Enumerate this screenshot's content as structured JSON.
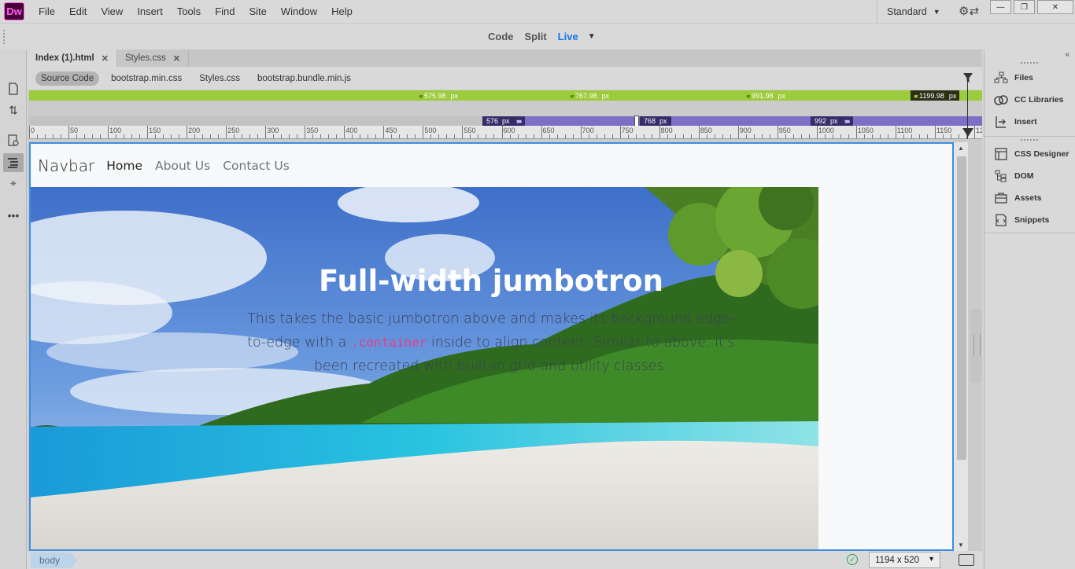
{
  "app": {
    "logo": "Dw"
  },
  "menu": [
    "File",
    "Edit",
    "View",
    "Insert",
    "Tools",
    "Find",
    "Site",
    "Window",
    "Help"
  ],
  "workspace": {
    "label": "Standard"
  },
  "view_modes": {
    "code": "Code",
    "split": "Split",
    "live": "Live",
    "active": "Live"
  },
  "tabs": [
    {
      "label": "Index (1).html",
      "active": true
    },
    {
      "label": "Styles.css",
      "active": false
    }
  ],
  "related_files": [
    "Source Code",
    "bootstrap.min.css",
    "Styles.css",
    "bootstrap.bundle.min.js"
  ],
  "media_queries_max": [
    "575.98",
    "767.98",
    "991.98",
    "1199.98"
  ],
  "media_queries_min": [
    "576",
    "768",
    "992"
  ],
  "px_unit": "px",
  "ruler_labels": [
    "0",
    "50",
    "100",
    "150",
    "200",
    "250",
    "300",
    "350",
    "400",
    "450",
    "500",
    "550",
    "600",
    "650",
    "700",
    "750",
    "800",
    "850",
    "900",
    "950",
    "1000",
    "1050",
    "1100",
    "1150",
    "12"
  ],
  "page": {
    "navbar": {
      "brand": "Navbar",
      "links": [
        {
          "label": "Home",
          "active": true
        },
        {
          "label": "About Us",
          "active": false
        },
        {
          "label": "Contact Us",
          "active": false
        }
      ]
    },
    "jumbotron": {
      "title": "Full-width jumbotron",
      "lead_part1": "This takes the basic jumbotron above and makes its background edge-to-edge with a ",
      "lead_code": ".container",
      "lead_part2": " inside to align content. Similar to above, it's been recreated with built-in grid and utility classes."
    }
  },
  "status": {
    "tag": "body",
    "window_size": "1194 x 520"
  },
  "right_panels_top": [
    "Files",
    "CC Libraries",
    "Insert"
  ],
  "right_panels_bottom": [
    "CSS Designer",
    "DOM",
    "Assets",
    "Snippets"
  ],
  "colors": {
    "accent": "#1473e6",
    "mq_green": "#9ccb3b",
    "mq_purple": "#7b6fc6",
    "logo_bg": "#470137",
    "logo_fg": "#ff61f6"
  }
}
